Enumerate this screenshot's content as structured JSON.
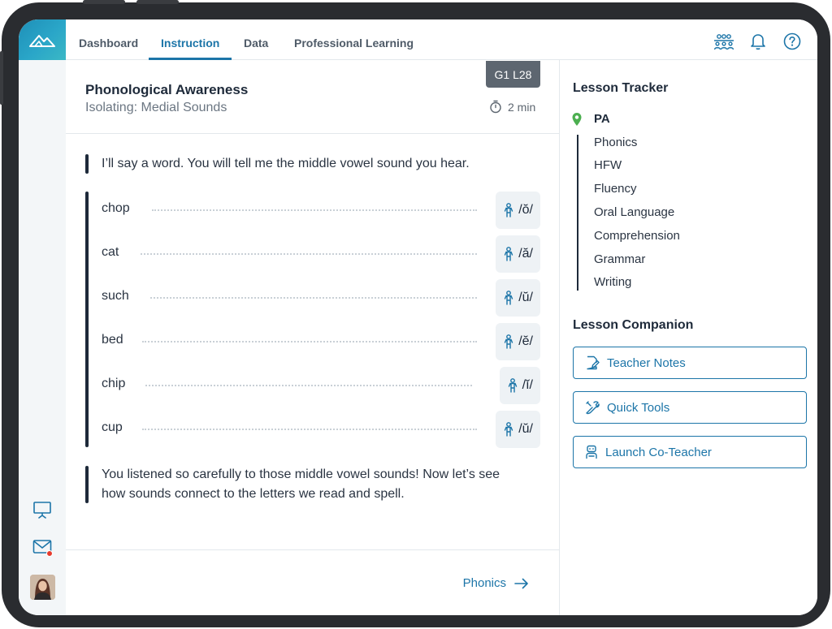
{
  "nav": {
    "tabs": [
      {
        "label": "Dashboard"
      },
      {
        "label": "Instruction"
      },
      {
        "label": "Data"
      },
      {
        "label": "Professional Learning"
      }
    ],
    "active_tab": "Instruction"
  },
  "lesson": {
    "title": "Phonological Awareness",
    "subtitle": "Isolating: Medial Sounds",
    "code": "G1 L28",
    "duration": "2 min",
    "intro": "I’ll say a word. You will tell me the middle vowel sound you hear.",
    "words": [
      {
        "word": "chop",
        "sound": "/ŏ/"
      },
      {
        "word": "cat",
        "sound": "/ă/"
      },
      {
        "word": "such",
        "sound": "/ŭ/"
      },
      {
        "word": "bed",
        "sound": "/ĕ/"
      },
      {
        "word": "chip",
        "sound": "/ĭ/"
      },
      {
        "word": "cup",
        "sound": "/ŭ/"
      }
    ],
    "closing_line1": "You listened so carefully to those middle vowel sounds! Now let’s see",
    "closing_line2": "how sounds connect to the letters we read and spell.",
    "next_label": "Phonics"
  },
  "tracker": {
    "heading": "Lesson Tracker",
    "current": "PA",
    "items": [
      "Phonics",
      "HFW",
      "Fluency",
      "Oral Language",
      "Comprehension",
      "Grammar",
      "Writing"
    ]
  },
  "companion": {
    "heading": "Lesson Companion",
    "buttons": [
      "Teacher Notes",
      "Quick Tools",
      "Launch Co-Teacher"
    ]
  },
  "colors": {
    "accent": "#1c75a8",
    "dark": "#1e2a3a",
    "tracker_pin": "#4caf50",
    "notification": "#e63b2e"
  }
}
